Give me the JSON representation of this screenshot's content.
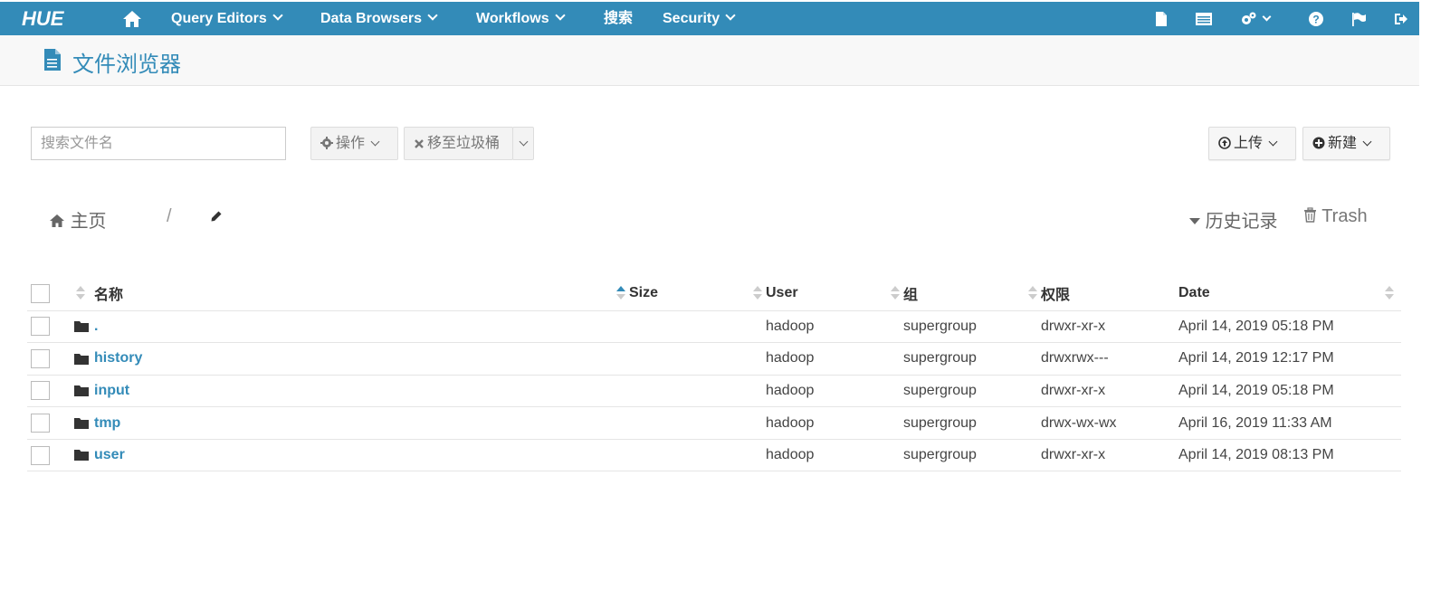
{
  "nav": {
    "logo": "HUE",
    "items": [
      {
        "label": "Query Editors",
        "caret": true
      },
      {
        "label": "Data Browsers",
        "caret": true
      },
      {
        "label": "Workflows",
        "caret": true
      },
      {
        "label": "搜索",
        "caret": false
      },
      {
        "label": "Security",
        "caret": true
      }
    ],
    "right_icons": [
      "file-icon",
      "table-icon",
      "cogs-icon",
      "help-icon",
      "flag-icon",
      "logout-icon"
    ]
  },
  "header": {
    "title": "文件浏览器",
    "icon": "file-icon"
  },
  "toolbar": {
    "search_placeholder": "搜索文件名",
    "actions_label": "操作",
    "move_trash_label": "移至垃圾桶",
    "upload_label": "上传",
    "new_label": "新建"
  },
  "breadcrumb": {
    "home_label": "主页",
    "separator": "/"
  },
  "history_label": "历史记录",
  "trash_label": "Trash",
  "table": {
    "columns": [
      "名称",
      "Size",
      "User",
      "组",
      "权限",
      "Date"
    ],
    "rows": [
      {
        "name": ".",
        "size": "",
        "user": "hadoop",
        "group": "supergroup",
        "perm": "drwxr-xr-x",
        "date": "April 14, 2019 05:18 PM"
      },
      {
        "name": "history",
        "size": "",
        "user": "hadoop",
        "group": "supergroup",
        "perm": "drwxrwx---",
        "date": "April 14, 2019 12:17 PM"
      },
      {
        "name": "input",
        "size": "",
        "user": "hadoop",
        "group": "supergroup",
        "perm": "drwxr-xr-x",
        "date": "April 14, 2019 05:18 PM"
      },
      {
        "name": "tmp",
        "size": "",
        "user": "hadoop",
        "group": "supergroup",
        "perm": "drwx-wx-wx",
        "date": "April 16, 2019 11:33 AM"
      },
      {
        "name": "user",
        "size": "",
        "user": "hadoop",
        "group": "supergroup",
        "perm": "drwxr-xr-x",
        "date": "April 14, 2019 08:13 PM"
      }
    ]
  },
  "colors": {
    "brand": "#338bb8",
    "link": "#338bb8"
  }
}
